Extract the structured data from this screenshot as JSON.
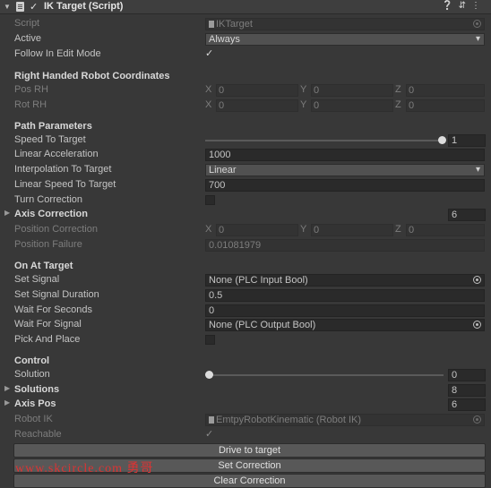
{
  "header": {
    "title": "IK Target (Script)"
  },
  "rows": {
    "script": {
      "label": "Script",
      "value": "IKTarget"
    },
    "active": {
      "label": "Active",
      "value": "Always"
    },
    "follow": {
      "label": "Follow In Edit Mode",
      "checked": true
    },
    "rh_section": "Right Handed Robot Coordinates",
    "pos_rh": {
      "label": "Pos RH",
      "x": "0",
      "y": "0",
      "z": "0"
    },
    "rot_rh": {
      "label": "Rot RH",
      "x": "0",
      "y": "0",
      "z": "0"
    },
    "path_section": "Path Parameters",
    "speed": {
      "label": "Speed To Target",
      "value": "1",
      "fraction": 1.0
    },
    "lin_acc": {
      "label": "Linear Acceleration",
      "value": "1000"
    },
    "interp": {
      "label": "Interpolation To Target",
      "value": "Linear"
    },
    "lin_speed": {
      "label": "Linear Speed To Target",
      "value": "700"
    },
    "turn": {
      "label": "Turn Correction",
      "checked": false
    },
    "axis_corr": {
      "label": "Axis Correction",
      "value": "6"
    },
    "pos_corr": {
      "label": "Position Correction",
      "x": "0",
      "y": "0",
      "z": "0"
    },
    "pos_fail": {
      "label": "Position Failure",
      "value": "0.01081979"
    },
    "target_section": "On At Target",
    "set_signal": {
      "label": "Set Signal",
      "value": "None (PLC Input Bool)"
    },
    "set_dur": {
      "label": "Set Signal Duration",
      "value": "0.5"
    },
    "wait_sec": {
      "label": "Wait For Seconds",
      "value": "0"
    },
    "wait_sig": {
      "label": "Wait For Signal",
      "value": "None (PLC Output Bool)"
    },
    "pick": {
      "label": "Pick And Place",
      "checked": false
    },
    "control_section": "Control",
    "solution": {
      "label": "Solution",
      "value": "0",
      "fraction": 0.0
    },
    "solutions": {
      "label": "Solutions",
      "value": "8"
    },
    "axis_pos": {
      "label": "Axis Pos",
      "value": "6"
    },
    "robot_ik": {
      "label": "Robot IK",
      "value": "EmtpyRobotKinematic (Robot IK)"
    },
    "reachable": {
      "label": "Reachable",
      "checked": true
    }
  },
  "axes": {
    "x": "X",
    "y": "Y",
    "z": "Z"
  },
  "buttons": {
    "drive": "Drive to target",
    "set_corr": "Set Correction",
    "clear_corr": "Clear Correction"
  },
  "watermark": "www.skcircle.com 勇哥",
  "icons": [
    "script-icon",
    "help-icon",
    "preset-icon",
    "menu-icon",
    "object-picker-icon",
    "checkmark-icon"
  ]
}
